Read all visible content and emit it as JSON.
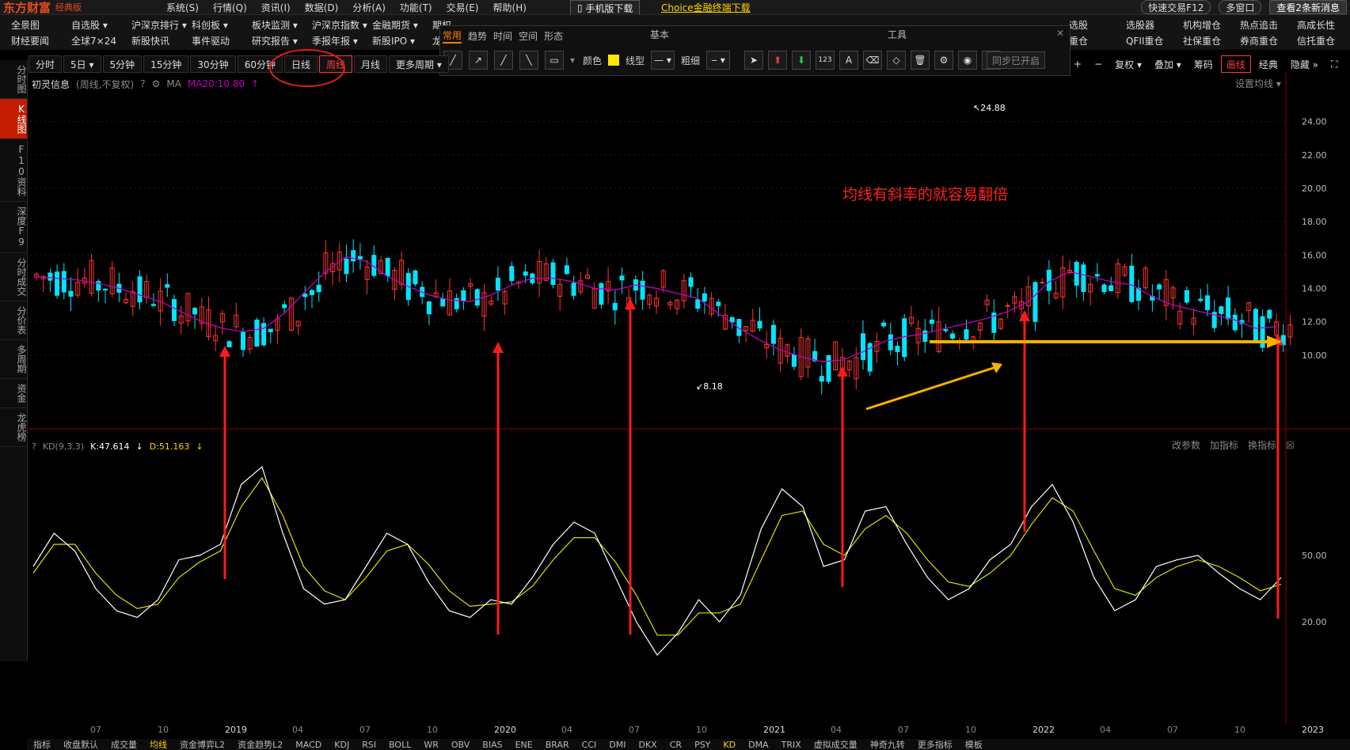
{
  "app": {
    "logo": "东方财富",
    "edition": "经典版"
  },
  "menu": [
    "系统(S)",
    "行情(Q)",
    "资讯(I)",
    "数据(D)",
    "分析(A)",
    "功能(T)",
    "交易(E)",
    "帮助(H)"
  ],
  "top": {
    "mobile_download": "手机版下载",
    "choice_download": "Choice金融终端下载",
    "quick_trade": "快速交易F12",
    "multi_window": "多窗口",
    "news": "查看2条新消息"
  },
  "nav_row1": [
    "全景图",
    "自选股 ▾",
    "沪深京排行 ▾",
    "科创板 ▾",
    "板块监测 ▾",
    "沪深京指数 ▾",
    "金融期货 ▾",
    "期权"
  ],
  "nav_row2": [
    "财经要闻",
    "全球7×24",
    "新股快讯",
    "事件驱动",
    "研究报告 ▾",
    "季报年报 ▾",
    "新股IPO ▾",
    "龙虎"
  ],
  "nav_right_row1": [
    "选股",
    "选股器",
    "机构增仓",
    "热点追击",
    "高成长性",
    "机构"
  ],
  "nav_right_row2": [
    "重仓",
    "QFII重仓",
    "社保重仓",
    "券商重仓",
    "信托重仓",
    ""
  ],
  "draw_panel": {
    "tabs": [
      "常用",
      "趋势",
      "时间",
      "空间",
      "形态"
    ],
    "active_tab": "常用",
    "sec_basic": "基本",
    "sec_tools": "工具",
    "color_label": "颜色",
    "line_type_label": "线型",
    "thickness_label": "粗细",
    "sync_label": "同步已开启",
    "color_value": "#ffe600"
  },
  "periods": [
    "分时",
    "5日 ▾",
    "5分钟",
    "15分钟",
    "30分钟",
    "60分钟",
    "日线",
    "周线",
    "月线",
    "更多周期 ▾"
  ],
  "active_period": "周线",
  "right_tools": [
    "+",
    "−",
    "复权 ▾",
    "叠加 ▾",
    "筹码",
    "画线",
    "经典",
    "隐藏 »"
  ],
  "left_tabs": [
    "分时图",
    "K线图",
    "F10资料",
    "深度F9",
    "分时成交",
    "分价表",
    "多周期",
    "资金",
    "龙虎榜"
  ],
  "chart": {
    "stock_name": "初灵信息",
    "mode": "(周线,不复权)",
    "ma_label": "MA",
    "ma20": "MA20:10.80",
    "ma_setting": "设置均线 ▾",
    "annotation": "均线有斜率的就容易翻倍",
    "high_label": "24.88",
    "low_label": "8.18"
  },
  "kd": {
    "name": "KD(9,3,3)",
    "k": "K:47.614",
    "d": "D:51.163",
    "tools": [
      "改参数",
      "加指标",
      "换指标"
    ]
  },
  "chart_data": {
    "type": "candlestick",
    "y_ticks_main": [
      "24.00",
      "22.00",
      "20.00",
      "18.00",
      "16.00",
      "14.00",
      "12.00",
      "10.00"
    ],
    "y_ticks_kd": [
      "50.00",
      "20.00"
    ],
    "x_ticks": [
      "07",
      "10",
      "2019",
      "04",
      "07",
      "10",
      "2020",
      "04",
      "07",
      "10",
      "2021",
      "04",
      "07",
      "10",
      "2022",
      "04",
      "07",
      "10",
      "2023"
    ],
    "ma20": [
      14.7,
      14.6,
      14.5,
      14.3,
      14.0,
      13.6,
      13.2,
      12.6,
      12.0,
      11.6,
      11.4,
      11.6,
      12.5,
      13.8,
      15.0,
      15.9,
      15.6,
      14.7,
      14.1,
      13.6,
      13.3,
      13.2,
      13.6,
      14.2,
      14.6,
      14.6,
      14.4,
      14.0,
      13.9,
      14.2,
      14.0,
      13.7,
      13.4,
      12.5,
      11.6,
      10.9,
      10.3,
      9.9,
      9.6,
      9.7,
      10.2,
      10.8,
      11.1,
      11.3,
      11.6,
      11.9,
      12.2,
      12.6,
      13.2,
      14.4,
      15.0,
      14.7,
      14.4,
      14.2,
      13.5,
      13.0,
      12.7,
      12.4,
      12.1,
      11.6,
      11.7
    ],
    "kd_k": [
      45,
      60,
      52,
      35,
      25,
      22,
      30,
      48,
      50,
      55,
      82,
      90,
      60,
      35,
      28,
      30,
      45,
      60,
      55,
      38,
      25,
      22,
      30,
      28,
      40,
      55,
      65,
      60,
      40,
      20,
      5,
      15,
      30,
      20,
      32,
      62,
      80,
      72,
      45,
      48,
      70,
      72,
      55,
      40,
      30,
      35,
      48,
      55,
      72,
      82,
      65,
      40,
      25,
      30,
      45,
      48,
      50,
      42,
      35,
      30,
      40
    ],
    "kd_d": [
      42,
      55,
      55,
      42,
      32,
      26,
      28,
      40,
      47,
      52,
      72,
      85,
      68,
      45,
      34,
      30,
      40,
      52,
      55,
      46,
      34,
      27,
      28,
      29,
      36,
      48,
      58,
      58,
      47,
      32,
      14,
      14,
      24,
      24,
      28,
      48,
      68,
      70,
      55,
      50,
      62,
      68,
      60,
      48,
      38,
      36,
      42,
      50,
      64,
      76,
      70,
      52,
      35,
      32,
      40,
      45,
      48,
      45,
      40,
      34,
      37
    ]
  }
}
